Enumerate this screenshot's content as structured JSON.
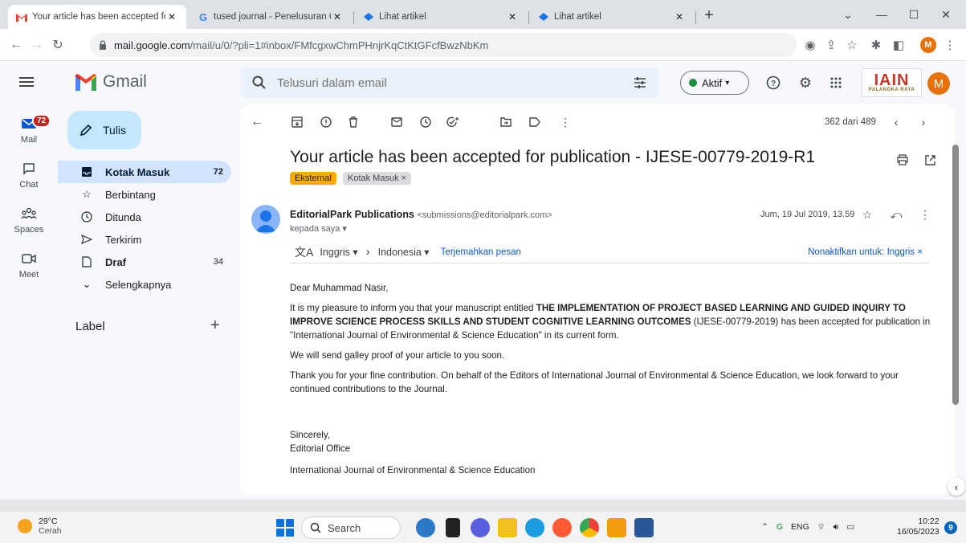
{
  "browser": {
    "tabs": [
      {
        "title": "Your article has been accepted fo",
        "active": true,
        "icon": "gmail-icon"
      },
      {
        "title": "tused journal - Penelusuran Goo",
        "active": false,
        "icon": "google-icon"
      },
      {
        "title": "Lihat artikel",
        "active": false,
        "icon": "site-icon"
      },
      {
        "title": "Lihat artikel",
        "active": false,
        "icon": "site-icon"
      }
    ],
    "new_tab": "+",
    "window_controls": {
      "dropdown": "⌄",
      "minimize": "—",
      "maximize": "☐",
      "close": "✕"
    },
    "url_host": "mail.google.com",
    "url_path": "/mail/u/0/?pli=1#inbox/FMfcgxwChmPHnjrKqCtKtGFcfBwzNbKm",
    "profile_initial": "M"
  },
  "gmail": {
    "app_name": "Gmail",
    "search_placeholder": "Telusuri dalam email",
    "status": "Aktif",
    "org_logo": {
      "big": "IAIN",
      "small": "PALANGKA RAYA"
    },
    "avatar_initial": "M",
    "rail": [
      {
        "label": "Mail",
        "badge": "72"
      },
      {
        "label": "Chat"
      },
      {
        "label": "Spaces"
      },
      {
        "label": "Meet"
      }
    ],
    "compose_label": "Tulis",
    "nav": [
      {
        "label": "Kotak Masuk",
        "count": "72",
        "active": true
      },
      {
        "label": "Berbintang",
        "count": ""
      },
      {
        "label": "Ditunda",
        "count": ""
      },
      {
        "label": "Terkirim",
        "count": ""
      },
      {
        "label": "Draf",
        "count": "34"
      },
      {
        "label": "Selengkapnya",
        "count": ""
      }
    ],
    "label_heading": "Label",
    "label_add": "+"
  },
  "email": {
    "pager": "362 dari 489",
    "subject": "Your article has been accepted for publication - IJESE-00779-2019-R1",
    "chips": {
      "external": "Eksternal",
      "inbox": "Kotak Masuk ×"
    },
    "sender_name": "EditorialPark Publications",
    "sender_email": "<submissions@editorialpark.com>",
    "to": "kepada saya ▾",
    "date": "Jum, 19 Jul 2019, 13.59",
    "translate": {
      "from": "Inggris ▾",
      "arrow": "›",
      "to": "Indonesia ▾",
      "action": "Terjemahkan pesan",
      "disable": "Nonaktifkan untuk: Inggris ×"
    },
    "body": {
      "greeting": "Dear Muhammad Nasir,",
      "p1_a": "It is my pleasure to inform you that your manuscript entitled ",
      "p1_title": "THE IMPLEMENTATION OF PROJECT BASED LEARNING AND GUIDED INQUIRY TO IMPROVE SCIENCE PROCESS SKILLS AND STUDENT COGNITIVE LEARNING OUTCOMES",
      "p1_b": " (IJESE-00779-2019) has been accepted for publication in \"International Journal of Environmental & Science Education\" in its current form.",
      "p2": "We will send galley proof of your article to you soon.",
      "p3": "Thank you for your fine contribution. On behalf of the Editors of International Journal of Environmental & Science Education, we look forward to your continued contributions to the Journal.",
      "closing": "Sincerely,",
      "signature": "Editorial Office",
      "journal": "International Journal of Environmental & Science Education"
    }
  },
  "taskbar": {
    "temperature": "29°C",
    "weather": "Cerah",
    "search_label": "Search",
    "tray_lang": "ENG",
    "time": "10:22",
    "date": "16/05/2023",
    "notifications": "9"
  },
  "colors": {
    "accent": "#0b57d0",
    "compose": "#c2e7ff",
    "active_nav": "#d3e3fd",
    "external_chip": "#f9ab00"
  }
}
